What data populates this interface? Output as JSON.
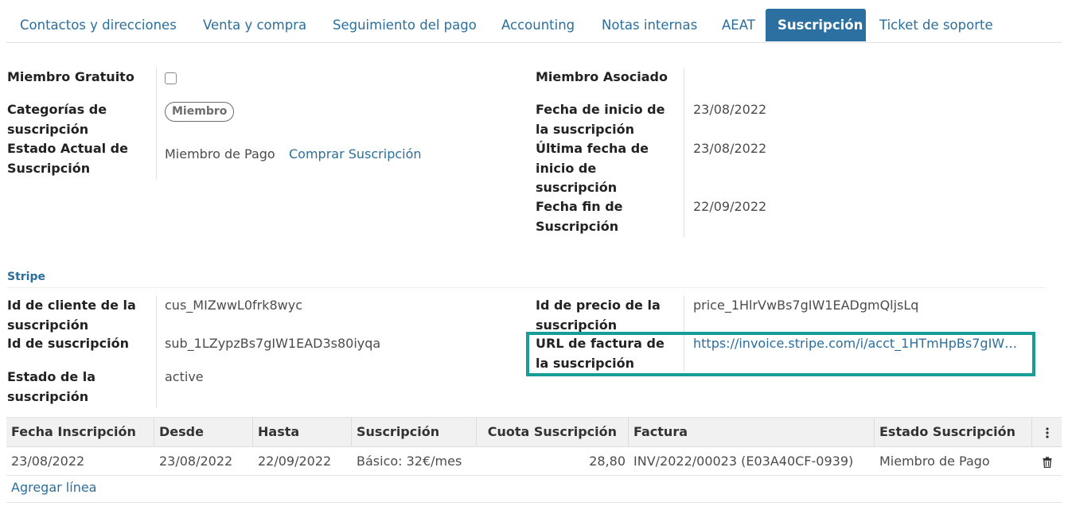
{
  "tabs": [
    {
      "label": "Contactos y direcciones"
    },
    {
      "label": "Venta y compra"
    },
    {
      "label": "Seguimiento del pago"
    },
    {
      "label": "Accounting"
    },
    {
      "label": "Notas internas"
    },
    {
      "label": "AEAT"
    },
    {
      "label": "Suscripción",
      "active": true
    },
    {
      "label": "Ticket de soporte"
    }
  ],
  "left": {
    "free_member_label": "Miembro Gratuito",
    "free_member_checked": false,
    "categories_label": "Categorías de suscripción",
    "categories_tag": "Miembro",
    "state_label": "Estado Actual de Suscripción",
    "state_value": "Miembro de Pago",
    "buy_link": "Comprar Suscripción"
  },
  "right": {
    "associated_label": "Miembro Asociado",
    "start_label": "Fecha de inicio de la suscripción",
    "start_value": "23/08/2022",
    "last_start_label": "Última fecha de inicio de suscripción",
    "last_start_value": "23/08/2022",
    "end_label": "Fecha fin de Suscripción",
    "end_value": "22/09/2022"
  },
  "stripe": {
    "section_title": "Stripe",
    "customer_id_label": "Id de cliente de la suscripción",
    "customer_id_value": "cus_MIZwwL0frk8wyc",
    "subscription_id_label": "Id de suscripción",
    "subscription_id_value": "sub_1LZypzBs7gIW1EAD3s80iyqa",
    "state_label": "Estado de la suscripción",
    "state_value": "active",
    "price_id_label": "Id de precio de la suscripción",
    "price_id_value": "price_1HlrVwBs7gIW1EADgmQljsLq",
    "invoice_url_label": "URL de factura de la suscripción",
    "invoice_url_value": "https://invoice.stripe.com/i/acct_1HTmHpBs7gIW1..."
  },
  "table": {
    "headers": [
      "Fecha Inscripción",
      "Desde",
      "Hasta",
      "Suscripción",
      "Cuota Suscripción",
      "Factura",
      "Estado Suscripción"
    ],
    "rows": [
      [
        "23/08/2022",
        "23/08/2022",
        "22/09/2022",
        "Básico: 32€/mes",
        "28,80",
        "INV/2022/00023 (E03A40CF-0939)",
        "Miembro de Pago"
      ]
    ],
    "add_line": "Agregar línea"
  },
  "colors": {
    "accent": "#2b70a0",
    "highlight": "#179c96"
  },
  "icons": [
    "kebab-menu-icon",
    "trash-icon",
    "checkbox-icon"
  ]
}
